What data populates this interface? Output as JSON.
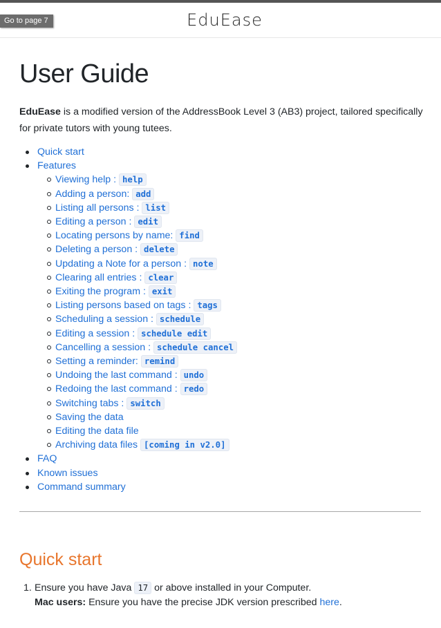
{
  "header": {
    "goto_label": "Go to page 7",
    "brand": "EduEase"
  },
  "page_title": "User Guide",
  "intro": {
    "bold": "EduEase",
    "rest": " is a modified version of the AddressBook Level 3 (AB3) project, tailored specifically for private tutors with young tutees."
  },
  "toc": {
    "quick_start": "Quick start",
    "features": "Features",
    "features_items": [
      {
        "label": "Viewing help : ",
        "code": "help"
      },
      {
        "label": "Adding a person: ",
        "code": "add"
      },
      {
        "label": "Listing all persons : ",
        "code": "list"
      },
      {
        "label": "Editing a person : ",
        "code": "edit"
      },
      {
        "label": "Locating persons by name: ",
        "code": "find"
      },
      {
        "label": "Deleting a person : ",
        "code": "delete"
      },
      {
        "label": "Updating a Note for a person : ",
        "code": "note"
      },
      {
        "label": "Clearing all entries : ",
        "code": "clear"
      },
      {
        "label": "Exiting the program : ",
        "code": "exit"
      },
      {
        "label": "Listing persons based on tags : ",
        "code": "tags"
      },
      {
        "label": "Scheduling a session : ",
        "code": "schedule"
      },
      {
        "label": "Editing a session : ",
        "code": "schedule edit"
      },
      {
        "label": "Cancelling a session : ",
        "code": "schedule cancel"
      },
      {
        "label": "Setting a reminder: ",
        "code": "remind"
      },
      {
        "label": "Undoing the last command : ",
        "code": "undo"
      },
      {
        "label": "Redoing the last command : ",
        "code": "redo"
      },
      {
        "label": "Switching tabs : ",
        "code": "switch"
      },
      {
        "label": "Saving the data",
        "code": ""
      },
      {
        "label": "Editing the data file",
        "code": ""
      },
      {
        "label": "Archiving data files ",
        "code": "[coming in v2.0]"
      }
    ],
    "faq": "FAQ",
    "known_issues": "Known issues",
    "command_summary": "Command summary"
  },
  "quick_start": {
    "heading": "Quick start",
    "step1_number": "1.",
    "step1_before": "Ensure you have Java ",
    "step1_code": "17",
    "step1_after": " or above installed in your Computer.",
    "mac_bold": "Mac users:",
    "mac_text": " Ensure you have the precise JDK version prescribed ",
    "mac_link": "here",
    "mac_end": "."
  }
}
